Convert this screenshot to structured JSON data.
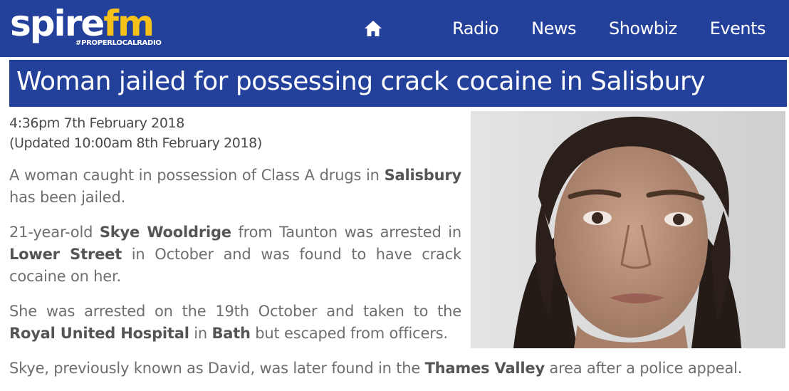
{
  "brand": {
    "logo_part1": "spire",
    "logo_part2": "fm",
    "tagline": "#PROPERLOCALRADIO",
    "colors": {
      "primary": "#23409a",
      "accent": "#f6c21a"
    }
  },
  "nav": {
    "home_icon": "home-icon",
    "items": [
      "Radio",
      "News",
      "Showbiz",
      "Events"
    ]
  },
  "article": {
    "title": "Woman jailed for possessing crack cocaine in Salisbury",
    "published": "4:36pm 7th February 2018",
    "updated": "(Updated 10:00am 8th February 2018)",
    "p1": {
      "t1": "A woman caught in possession of Class A drugs in ",
      "b1": "Salisbury",
      "t2": " has been jailed."
    },
    "p2": {
      "t1": "21-year-old ",
      "b1": "Skye Wooldrige",
      "t2": " from Taunton was arrested in ",
      "b2": "Lower Street",
      "t3": " in October and was found to have crack cocaine on her."
    },
    "p3": {
      "t1": "She was arrested on the 19th October and taken to the ",
      "b1": "Royal United Hospital",
      "t2": " in ",
      "b2": "Bath",
      "t3": " but escaped from officers."
    },
    "p4": {
      "t1": "Skye, previously known as David, was later found in the ",
      "b1": "Thames Valley",
      "t2": " area after a police appeal."
    },
    "image_alt": "police custody photo"
  }
}
